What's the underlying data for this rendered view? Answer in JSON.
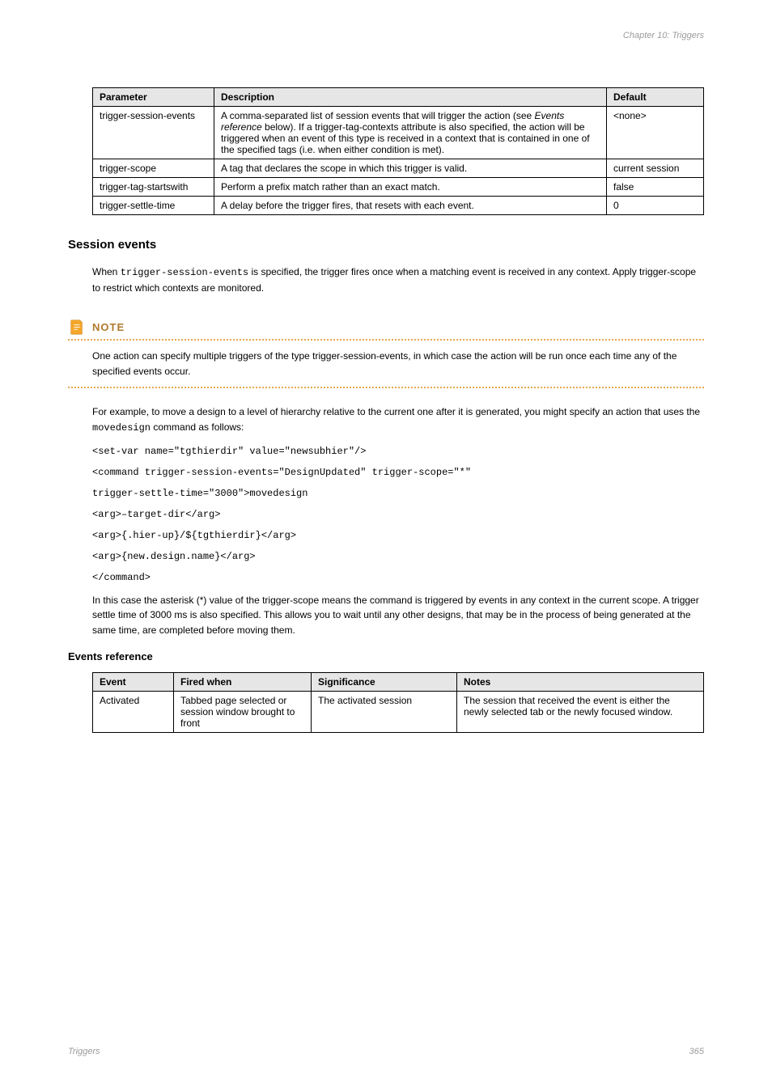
{
  "header_chapter": "Chapter 10: Triggers",
  "table1": {
    "headers": [
      "Parameter",
      "Description",
      "Default"
    ],
    "rows": [
      {
        "param": "trigger-session-events",
        "desc_pre": "A comma-separated list of session events that will trigger the action (see ",
        "desc_ref": "Events reference",
        "desc_post": " below). If a trigger-tag-contexts attribute is also specified, the action will be triggered when an event of this type is received in a context that is contained in one of the specified tags (i.e. when either condition is met).",
        "def": "<none>"
      },
      {
        "param": "trigger-scope",
        "desc": "A tag that declares the scope in which this trigger is valid.",
        "def": "current session"
      },
      {
        "param": "trigger-tag-startswith",
        "desc": "Perform a prefix match rather than an exact match.",
        "def": "false"
      },
      {
        "param": "trigger-settle-time",
        "desc": "A delay before the trigger fires, that resets with each event.",
        "def": "0"
      }
    ]
  },
  "section_session_title": "Session events",
  "session_p1_pre": "When ",
  "session_p1_attr": "trigger-session-events",
  "session_p1_post": " is specified, the trigger fires once when a matching event is received in any context. Apply trigger-scope to restrict which contexts are monitored.",
  "note_label": "NOTE",
  "note_text": "One action can specify multiple triggers of the type trigger-session-events, in which case the action will be run once each time any of the specified events occur.",
  "session_p2_pre": "For example, to move a design to a level of hierarchy relative to the current one after it is generated, you might specify an action that uses the ",
  "session_p2_mono": "movedesign",
  "session_p2_post": " command as follows:",
  "code_lines": [
    "<set-var name=\"tgthierdir\" value=\"newsubhier\"/>",
    "<command trigger-session-events=\"DesignUpdated\" trigger-scope=\"*\"",
    "            trigger-settle-time=\"3000\">movedesign",
    "  <arg>–target-dir</arg>",
    "  <arg>{.hier-up}/${tgthierdir}</arg>",
    "  <arg>{new.design.name}</arg>",
    "</command>"
  ],
  "session_p3": "In this case the asterisk (*) value of the trigger-scope means the command is triggered by events in any context in the current scope. A trigger settle time of 3000 ms is also specified. This allows you to wait until any other designs, that may be in the process of being generated at the same time, are completed before moving them.",
  "events_ref_title": "Events reference",
  "table2": {
    "headers": [
      "Event",
      "Fired when",
      "Significance",
      "Notes"
    ],
    "rows": [
      {
        "event": "Activated",
        "when": "Tabbed page selected or session window brought to front",
        "sig": "The activated session",
        "notes": "The session that received the event is either the newly selected tab or the newly focused window."
      }
    ]
  },
  "footer_left": "Triggers",
  "footer_right": "365"
}
